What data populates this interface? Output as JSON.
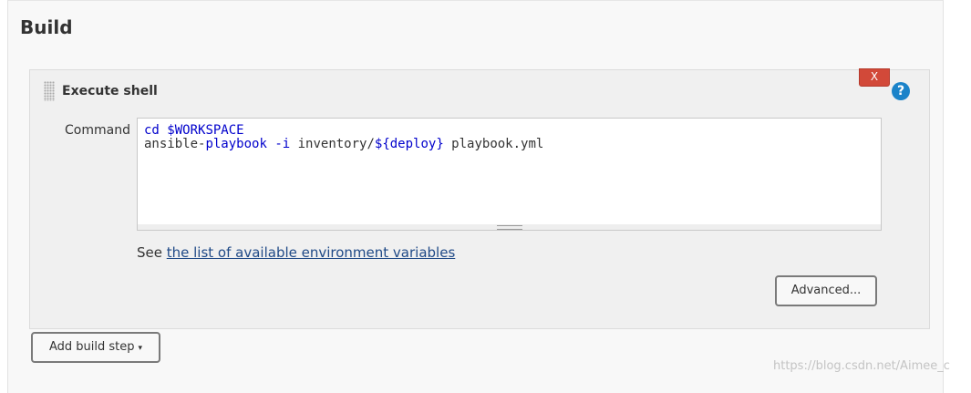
{
  "section": {
    "title": "Build"
  },
  "step": {
    "title": "Execute shell",
    "delete_label": "X",
    "help_label": "?",
    "command_label": "Command",
    "command": {
      "line1": {
        "kw1": "cd",
        "sp": " ",
        "kw2": "$WORKSPACE"
      },
      "line2": {
        "t1": "ansible-",
        "k1": "playbook",
        "t2": " ",
        "k2": "-i",
        "t3": " inventory/",
        "k3": "${deploy}",
        "t4": " playbook.yml"
      }
    },
    "env_prefix": "See ",
    "env_link": "the list of available environment variables",
    "advanced_label": "Advanced..."
  },
  "add_build_step": {
    "label": "Add build step",
    "caret": "▾"
  },
  "watermark": "https://blog.csdn.net/Aimee_c",
  "colors": {
    "delete": "#d24939",
    "help": "#1b83c9",
    "link": "#204a87",
    "keyword": "#0000cc"
  }
}
